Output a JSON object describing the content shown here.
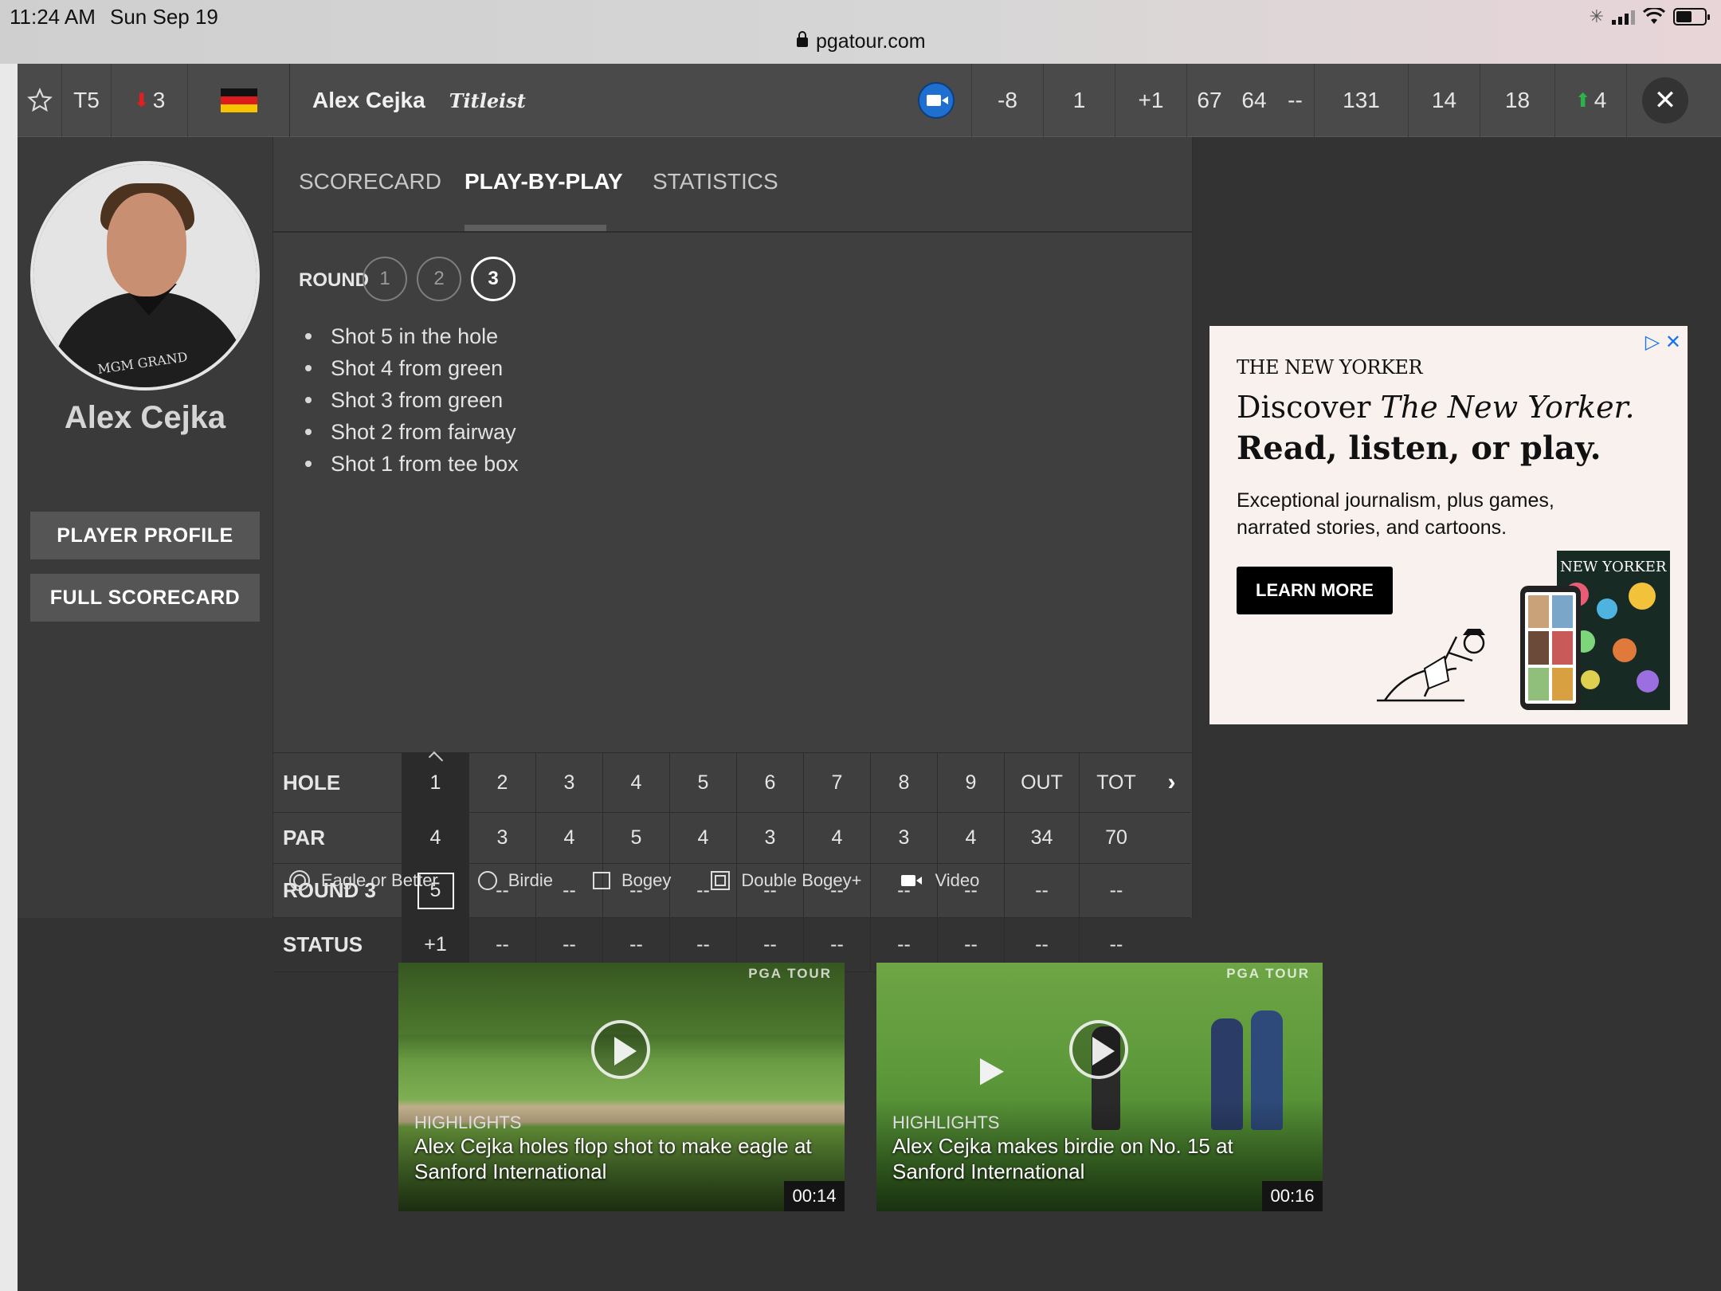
{
  "status_bar": {
    "time": "11:24 AM",
    "date": "Sun Sep 19",
    "url": "pgatour.com"
  },
  "topbar": {
    "position": "T5",
    "movement": "3",
    "player_name": "Alex Cejka",
    "sponsor": "Titleist",
    "to_par": "-8",
    "thru": "1",
    "today": "+1",
    "r1": "67",
    "r2": "64",
    "r3": "--",
    "total": "131",
    "stat1": "14",
    "stat2": "18",
    "stat3": "4",
    "close": "✕"
  },
  "player": {
    "photo_logo": "MGM GRAND",
    "name": "Alex Cejka",
    "profile_button": "PLAYER PROFILE",
    "scorecard_button": "FULL SCORECARD"
  },
  "tabs": [
    {
      "label": "SCORECARD"
    },
    {
      "label": "PLAY-BY-PLAY"
    },
    {
      "label": "STATISTICS"
    }
  ],
  "round": {
    "label": "ROUND",
    "options": [
      "1",
      "2",
      "3"
    ]
  },
  "shots": [
    "Shot 5 in the hole",
    "Shot 4 from green",
    "Shot 3 from green",
    "Shot 2 from fairway",
    "Shot 1 from tee box"
  ],
  "scorecard": {
    "rows": [
      {
        "label": "HOLE",
        "cells": [
          "1",
          "2",
          "3",
          "4",
          "5",
          "6",
          "7",
          "8",
          "9",
          "OUT",
          "TOT"
        ]
      },
      {
        "label": "PAR",
        "cells": [
          "4",
          "3",
          "4",
          "5",
          "4",
          "3",
          "4",
          "3",
          "4",
          "34",
          "70"
        ]
      },
      {
        "label": "ROUND 3",
        "cells": [
          "5",
          "--",
          "--",
          "--",
          "--",
          "--",
          "--",
          "--",
          "--",
          "--",
          "--"
        ]
      },
      {
        "label": "STATUS",
        "cells": [
          "+1",
          "--",
          "--",
          "--",
          "--",
          "--",
          "--",
          "--",
          "--",
          "--",
          "--"
        ]
      }
    ]
  },
  "legend": {
    "eagle": "Eagle or Better",
    "birdie": "Birdie",
    "bogey": "Bogey",
    "double_bogey": "Double Bogey+",
    "video": "Video"
  },
  "ad": {
    "brand": "THE NEW YORKER",
    "headline_a": "Discover ",
    "headline_b": "The New Yorker.",
    "headline2": "Read, listen, or play.",
    "body": "Exceptional journalism, plus games, narrated stories, and cartoons.",
    "cta": "LEARN MORE",
    "cover_title": "NEW YORKER"
  },
  "videos": [
    {
      "kicker": "HIGHLIGHTS",
      "title": "Alex Cejka holes flop shot to make eagle at Sanford International",
      "duration": "00:14",
      "logo": "PGA TOUR"
    },
    {
      "kicker": "HIGHLIGHTS",
      "title": "Alex Cejka makes birdie on No. 15 at Sanford International",
      "duration": "00:16",
      "logo": "PGA TOUR"
    }
  ],
  "colors": {
    "accent_video": "#1f6fd1",
    "down_arrow": "#e02020",
    "up_arrow": "#2cb34a"
  }
}
